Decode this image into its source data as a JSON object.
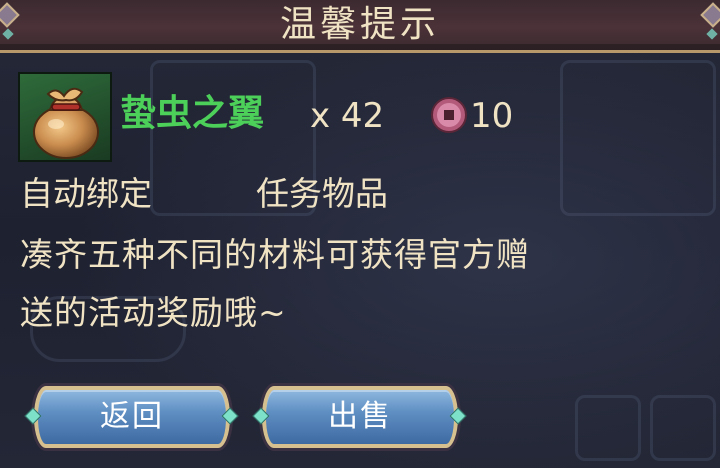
{
  "dialog": {
    "title": "温馨提示"
  },
  "item": {
    "name": "蛰虫之翼",
    "quantity": "x 42",
    "price": "10",
    "icon": "money-bag-icon",
    "name_color": "#4dd05a"
  },
  "tags": [
    "自动绑定",
    "任务物品"
  ],
  "description": {
    "line1": "凑齐五种不同的材料可获得官方赠",
    "line2": "送的活动奖励哦~"
  },
  "buttons": {
    "back_label": "返回",
    "sell_label": "出售"
  },
  "colors": {
    "text": "#f0e3c4",
    "title_bar": "#4b3238",
    "button": "#5f8fc3",
    "button_border": "#d7c08f"
  }
}
